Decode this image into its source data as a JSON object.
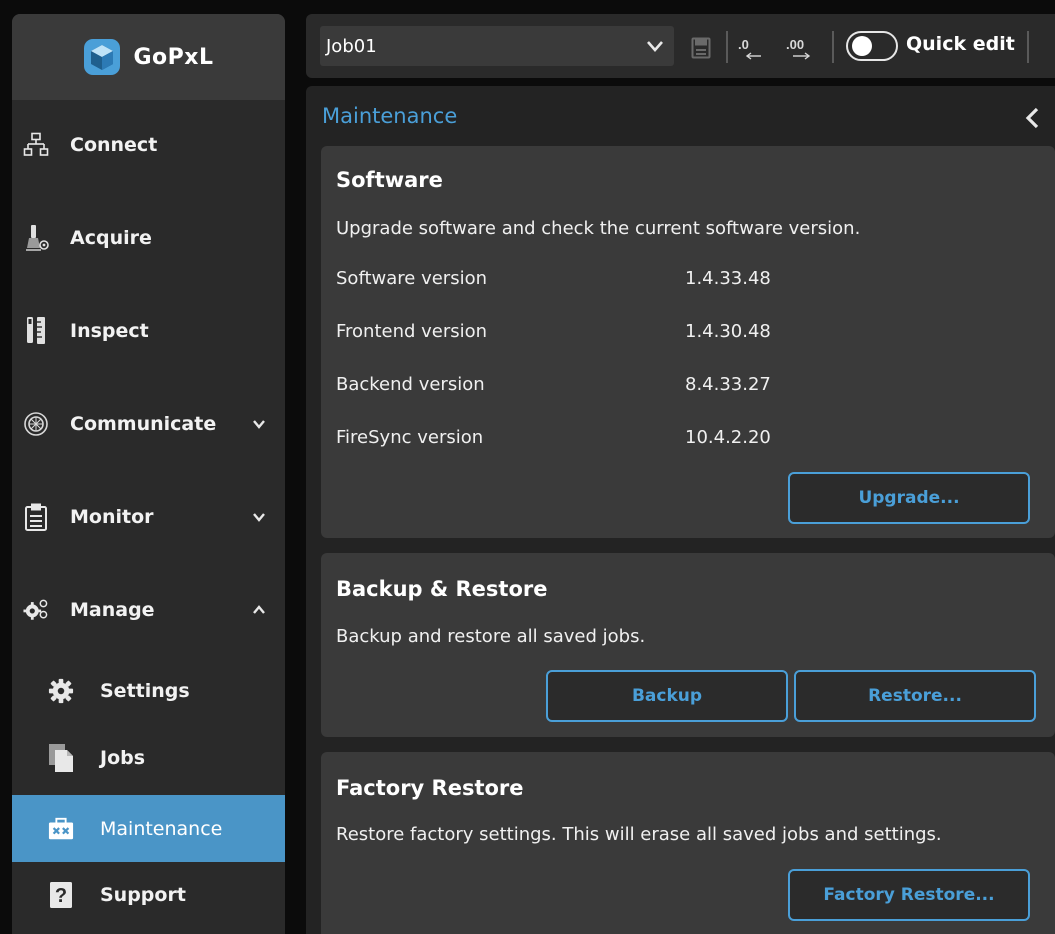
{
  "brand": {
    "name": "GoPxL"
  },
  "sidebar": {
    "items": [
      {
        "label": "Connect",
        "icon": "network-icon"
      },
      {
        "label": "Acquire",
        "icon": "acquire-icon"
      },
      {
        "label": "Inspect",
        "icon": "inspect-icon"
      },
      {
        "label": "Communicate",
        "icon": "communicate-icon",
        "expanded": false
      },
      {
        "label": "Monitor",
        "icon": "clipboard-icon",
        "expanded": false
      },
      {
        "label": "Manage",
        "icon": "gears-icon",
        "expanded": true
      }
    ],
    "sub_items": [
      {
        "label": "Settings",
        "icon": "gear-icon"
      },
      {
        "label": "Jobs",
        "icon": "files-icon"
      },
      {
        "label": "Maintenance",
        "icon": "toolbox-icon",
        "active": true
      },
      {
        "label": "Support",
        "icon": "help-icon"
      }
    ]
  },
  "toolbar": {
    "job": "Job01",
    "quick_edit_label": "Quick edit",
    "quick_edit_on": false,
    "decimal_left_glyph": ".0",
    "decimal_right_glyph": ".00"
  },
  "main": {
    "title": "Maintenance",
    "software": {
      "title": "Software",
      "description": "Upgrade software and check the current software version.",
      "rows": [
        {
          "key": "Software version",
          "value": "1.4.33.48"
        },
        {
          "key": "Frontend version",
          "value": "1.4.30.48"
        },
        {
          "key": "Backend version",
          "value": "8.4.33.27"
        },
        {
          "key": "FireSync version",
          "value": "10.4.2.20"
        }
      ],
      "upgrade_label": "Upgrade..."
    },
    "backup": {
      "title": "Backup & Restore",
      "description": "Backup and restore all saved jobs.",
      "backup_label": "Backup",
      "restore_label": "Restore..."
    },
    "factory": {
      "title": "Factory Restore",
      "description": "Restore factory settings. This will erase all saved jobs and settings.",
      "button_label": "Factory Restore..."
    }
  },
  "colors": {
    "accent": "#4a9fd8",
    "active_nav": "#4a95c7",
    "card": "#3a3a3a",
    "panel": "#232323",
    "sidebar": "#2a2a2a"
  }
}
